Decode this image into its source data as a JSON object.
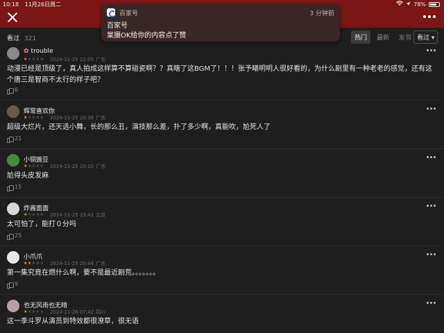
{
  "status": {
    "time": "10:18",
    "date": "11月26日周二",
    "battery": "78%",
    "battery_level": 0.78
  },
  "notification": {
    "app": "百家号",
    "time": "3 分钟前",
    "title": "百家号",
    "body": "棠摄OK给你的内容点了赞"
  },
  "header": {
    "views_label": "看过",
    "views_count": "321",
    "tabs": [
      {
        "label": "热门",
        "active": true
      },
      {
        "label": "最新",
        "active": false
      },
      {
        "label": "友邻",
        "active": false
      }
    ],
    "filter": "看过 ▾"
  },
  "comments": [
    {
      "name": "trouble",
      "stars": 1,
      "date": "2024-11-25 22:05",
      "location": "广东",
      "text": "动漫已经是顶级了，真人拍成这样算不算碰瓷啊？？真瞎了这BGM了！！！张予曦明明人很好看的，为什么剧里有一种老老的感觉，还有这个唐三是智商不太行的样子吧？",
      "likes": "6",
      "avatar_color": "#8a8a8a"
    },
    {
      "name": "辉常喜欢你",
      "stars": 1,
      "date": "2024-11-25 20:38",
      "location": "广东",
      "text": "超级大烂片，还天选小舞，长的那么丑，演技那么差，扑了多少啊，真能吹，尬死人了",
      "likes": "21",
      "avatar_color": "#6b5a48"
    },
    {
      "name": "小铜豌豆",
      "stars": 1,
      "date": "2024-11-25 20:10",
      "location": "广东",
      "text": "尬得头皮发麻",
      "likes": "15",
      "avatar_color": "#4a8a3a"
    },
    {
      "name": "炸酱面面",
      "stars": 1,
      "date": "2024-11-25 19:42",
      "location": "北京",
      "text": "太可怕了，能打０分吗",
      "likes": "25",
      "avatar_color": "#d8d8d8"
    },
    {
      "name": "小爪爪",
      "stars": 2,
      "date": "2024-11-25 20:44",
      "location": "广东",
      "text": "第一集究竟在燃什么啊，要不是最近剧荒。。。。。。。",
      "likes": "9",
      "avatar_color": "#e8e8e8"
    },
    {
      "name": "也无风雨也无晴",
      "stars": 1,
      "date": "2024-11-26 07:42",
      "location": "四川",
      "text": "这一季斗罗从演员到特效都很潦草，很无语",
      "likes": "",
      "avatar_color": "#b8a0a8"
    }
  ]
}
